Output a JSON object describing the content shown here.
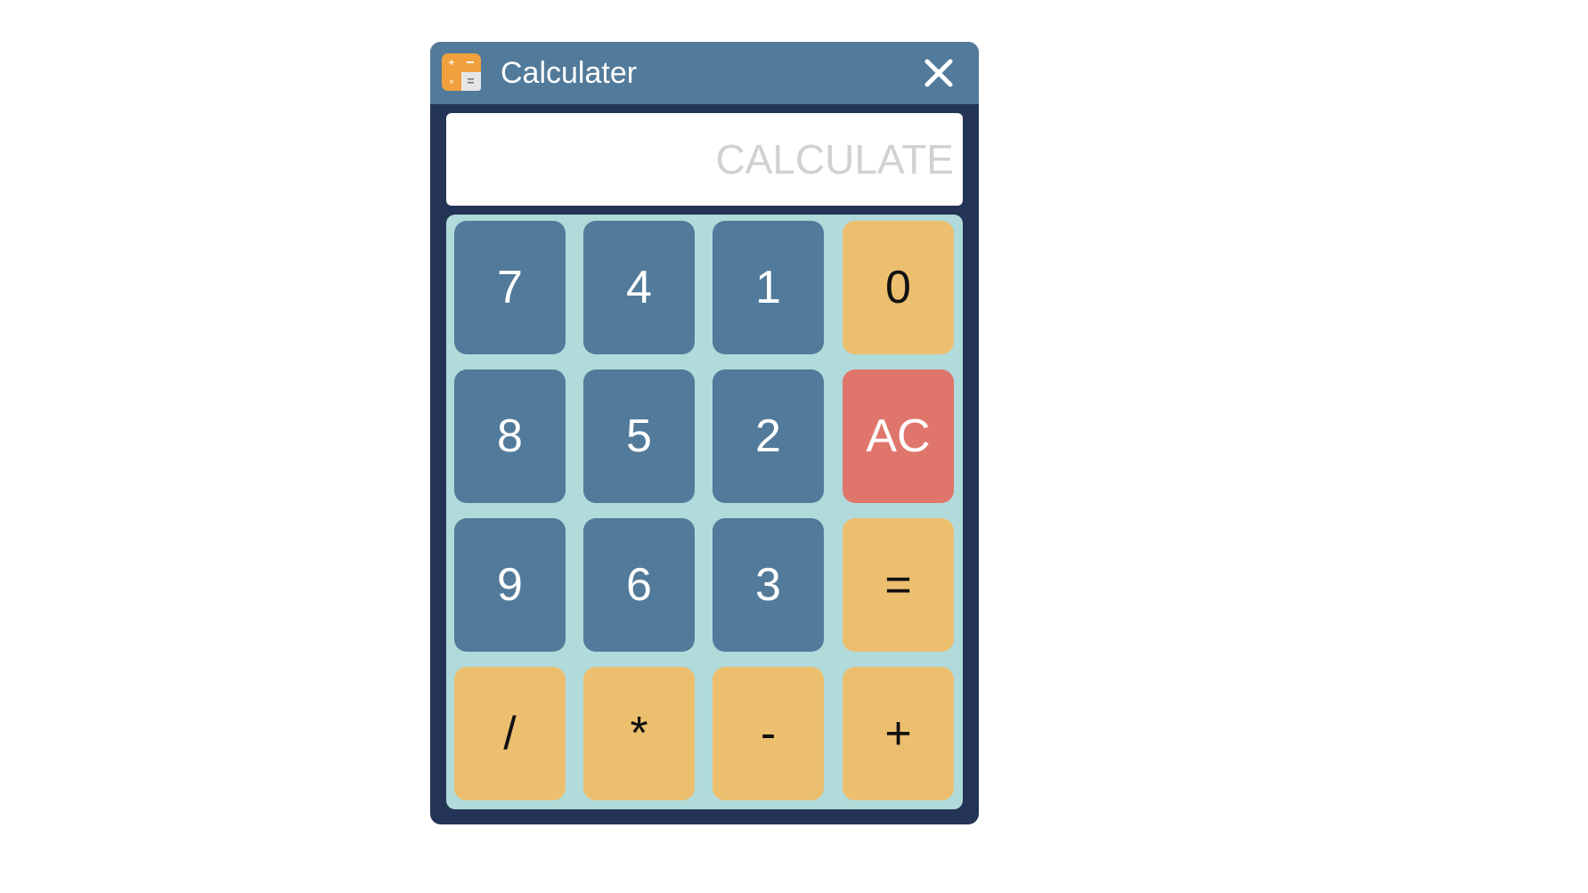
{
  "window": {
    "title": "Calculater",
    "icon": "calculator-app-icon",
    "close_icon": "close-icon"
  },
  "display": {
    "value": "",
    "placeholder": "CALCULATE"
  },
  "keys": {
    "k7": "7",
    "k4": "4",
    "k1": "1",
    "k0": "0",
    "k8": "8",
    "k5": "5",
    "k2": "2",
    "clear": "AC",
    "k9": "9",
    "k6": "6",
    "k3": "3",
    "equals": "=",
    "divide": "/",
    "multiply": "*",
    "subtract": "-",
    "add": "+"
  },
  "colors": {
    "titlebar": "#527a9a",
    "window_border": "#243456",
    "keypad_bg": "#b1dadb",
    "number_key": "#527a9a",
    "operator_key": "#ecbf6f",
    "clear_key": "#e0766b",
    "display_bg": "#ffffff"
  }
}
